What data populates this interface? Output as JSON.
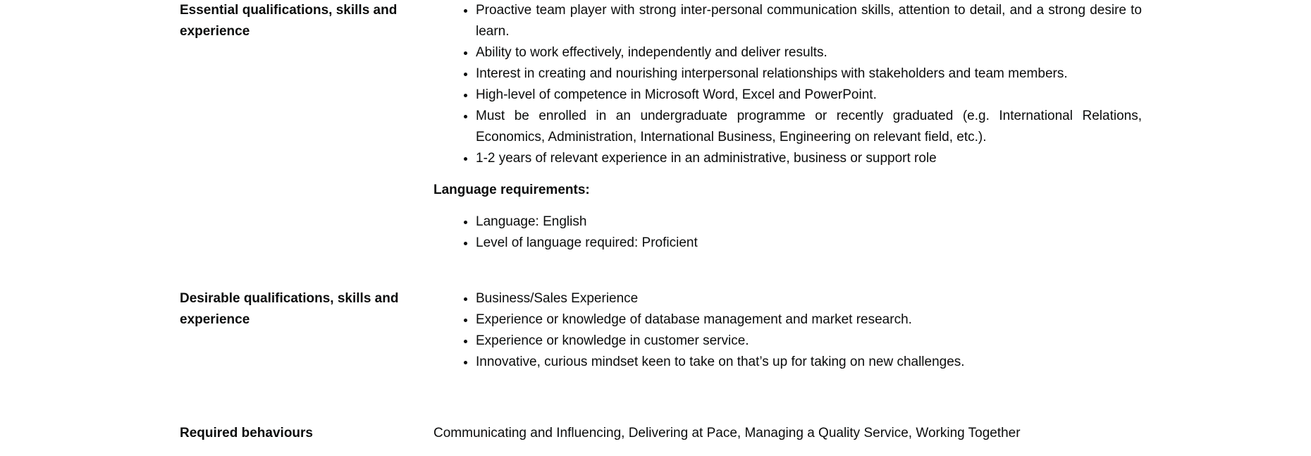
{
  "essential": {
    "label": "Essential qualifications, skills and experience",
    "items": [
      "Proactive team player with strong inter-personal communication skills, attention to detail, and a strong desire to learn.",
      "Ability to work effectively, independently and deliver results.",
      "Interest in creating and nourishing interpersonal relationships with stakeholders and team members.",
      "High-level of competence in Microsoft Word, Excel and PowerPoint.",
      "Must be enrolled in an undergraduate programme or recently graduated (e.g. International Relations, Economics, Administration, International Business, Engineering on relevant field, etc.).",
      "1-2 years of relevant experience in an administrative, business or support role"
    ],
    "language_heading": "Language requirements:",
    "language_items": [
      "Language: English",
      "Level of language required: Proficient"
    ]
  },
  "desirable": {
    "label": "Desirable qualifications, skills and experience",
    "items": [
      "Business/Sales Experience",
      "Experience or knowledge of database management and market research.",
      "Experience or knowledge in customer service.",
      "Innovative, curious mindset keen to take on that’s up for taking on new challenges."
    ]
  },
  "behaviours": {
    "label": "Required behaviours",
    "value": "Communicating and Influencing, Delivering at Pace, Managing a Quality Service, Working Together"
  }
}
